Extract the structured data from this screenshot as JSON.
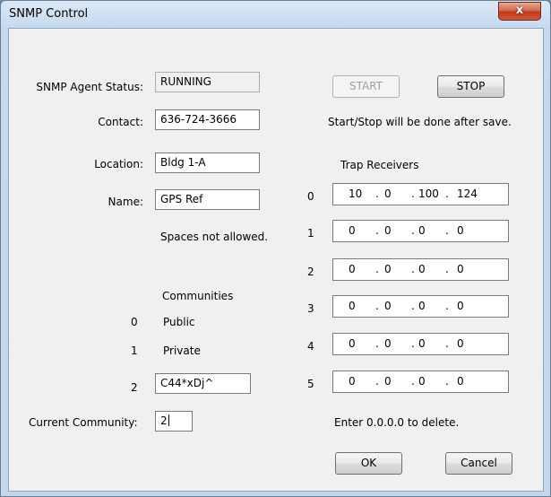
{
  "window": {
    "title": "SNMP Control",
    "close_glyph": "x"
  },
  "status": {
    "label": "SNMP Agent Status:",
    "value": "RUNNING"
  },
  "contact": {
    "label": "Contact:",
    "value": "636-724-3666"
  },
  "location": {
    "label": "Location:",
    "value": "Bldg 1-A"
  },
  "name": {
    "label": "Name:",
    "value": "GPS Ref",
    "note": "Spaces not allowed."
  },
  "buttons": {
    "start": "START",
    "stop": "STOP",
    "ok": "OK",
    "cancel": "Cancel"
  },
  "start_stop_note": "Start/Stop will be done after save.",
  "trap": {
    "heading": "Trap Receivers",
    "receivers": [
      {
        "index": "0",
        "octets": [
          "10",
          "0",
          "100",
          "124"
        ]
      },
      {
        "index": "1",
        "octets": [
          "0",
          "0",
          "0",
          "0"
        ]
      },
      {
        "index": "2",
        "octets": [
          "0",
          "0",
          "0",
          "0"
        ]
      },
      {
        "index": "3",
        "octets": [
          "0",
          "0",
          "0",
          "0"
        ]
      },
      {
        "index": "4",
        "octets": [
          "0",
          "0",
          "0",
          "0"
        ]
      },
      {
        "index": "5",
        "octets": [
          "0",
          "0",
          "0",
          "0"
        ]
      }
    ],
    "delete_note": "Enter 0.0.0.0 to delete."
  },
  "communities": {
    "heading": "Communities",
    "items": [
      {
        "index": "0",
        "value": "Public"
      },
      {
        "index": "1",
        "value": "Private"
      },
      {
        "index": "2",
        "value": "C44*xDj^"
      }
    ]
  },
  "current_community": {
    "label": "Current Community:",
    "value": "2"
  },
  "ip_dot": "."
}
